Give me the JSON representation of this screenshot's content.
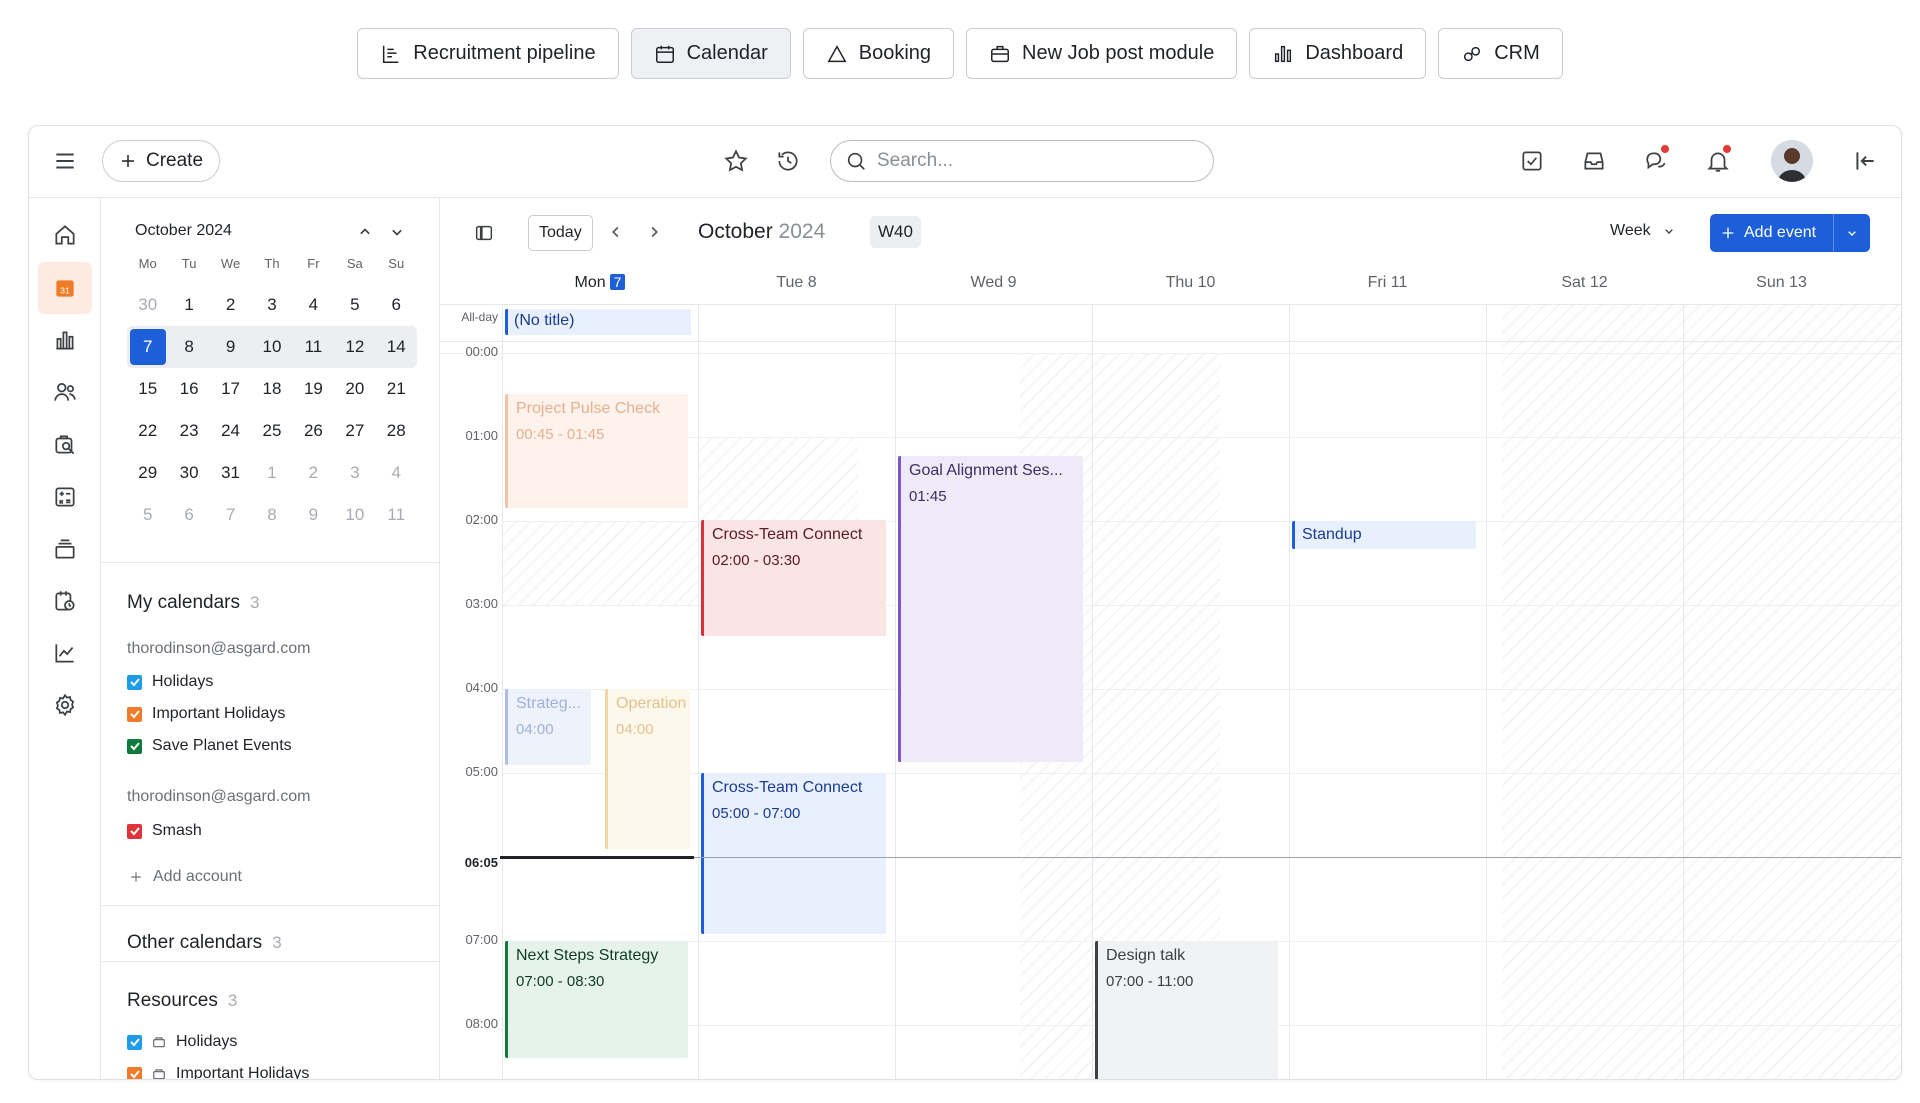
{
  "module_tabs": [
    {
      "label": "Recruitment pipeline",
      "icon": "pipeline-icon",
      "active": false
    },
    {
      "label": "Calendar",
      "icon": "calendar-icon",
      "active": true
    },
    {
      "label": "Booking",
      "icon": "triangle-icon",
      "active": false
    },
    {
      "label": "New Job post module",
      "icon": "briefcase-icon",
      "active": false
    },
    {
      "label": "Dashboard",
      "icon": "bar-chart-icon",
      "active": false
    },
    {
      "label": "CRM",
      "icon": "link-icon",
      "active": false
    }
  ],
  "topbar": {
    "create_label": "Create",
    "search_placeholder": "Search..."
  },
  "mini_calendar": {
    "title": "October 2024",
    "weekdays": [
      "Mo",
      "Tu",
      "We",
      "Th",
      "Fr",
      "Sa",
      "Su"
    ],
    "weeks": [
      [
        "30",
        "1",
        "2",
        "3",
        "4",
        "5",
        "6"
      ],
      [
        "7",
        "8",
        "9",
        "10",
        "11",
        "12",
        "14"
      ],
      [
        "15",
        "16",
        "17",
        "18",
        "19",
        "20",
        "21"
      ],
      [
        "22",
        "23",
        "24",
        "25",
        "26",
        "27",
        "28"
      ],
      [
        "29",
        "30",
        "31",
        "1",
        "2",
        "3",
        "4"
      ],
      [
        "5",
        "6",
        "7",
        "8",
        "9",
        "10",
        "11"
      ]
    ],
    "selected_day": "7"
  },
  "my_calendars": {
    "title": "My calendars",
    "count": "3",
    "accounts": [
      {
        "email": "thorodinson@asgard.com",
        "items": [
          {
            "label": "Holidays",
            "color": "#1e9be9"
          },
          {
            "label": "Important Holidays",
            "color": "#f07c2a"
          },
          {
            "label": "Save Planet Events",
            "color": "#0f7b3b"
          }
        ]
      },
      {
        "email": "thorodinson@asgard.com",
        "items": [
          {
            "label": "Smash",
            "color": "#e0333a"
          }
        ]
      }
    ],
    "add_account": "Add account"
  },
  "other_calendars": {
    "title": "Other calendars",
    "count": "3"
  },
  "resources": {
    "title": "Resources",
    "count": "3",
    "items": [
      {
        "label": "Holidays",
        "color": "#1e9be9"
      },
      {
        "label": "Important Holidays",
        "color": "#f07c2a"
      }
    ]
  },
  "toolbar": {
    "today": "Today",
    "month": "October",
    "year": "2024",
    "week": "W40",
    "view": "Week",
    "add_event": "Add event"
  },
  "days": [
    {
      "name": "Mon",
      "num": "7",
      "today": true
    },
    {
      "name": "Tue 8"
    },
    {
      "name": "Wed 9"
    },
    {
      "name": "Thu 10"
    },
    {
      "name": "Fri 11"
    },
    {
      "name": "Sat 12"
    },
    {
      "name": "Sun 13"
    }
  ],
  "allday_label": "All-day",
  "hours": [
    "00:00",
    "01:00",
    "02:00",
    "03:00",
    "04:00",
    "05:00",
    "06:05",
    "07:00",
    "08:00"
  ],
  "now_label": "06:05",
  "events": [
    {
      "title": "(No title)",
      "time": ""
    },
    {
      "title": "Project Pulse Check",
      "time": "00:45 - 01:45"
    },
    {
      "title": "Goal Alignment Ses...",
      "time": "01:45"
    },
    {
      "title": "Cross-Team Connect",
      "time": "02:00 - 03:30"
    },
    {
      "title": "Standup",
      "time": ""
    },
    {
      "title": "Strateg...",
      "time": "04:00"
    },
    {
      "title": "Operation",
      "time": "04:00"
    },
    {
      "title": "Cross-Team Connect",
      "time": "05:00 - 07:00"
    },
    {
      "title": "Next Steps Strategy",
      "time": "07:00 - 08:30"
    },
    {
      "title": "Design talk",
      "time": "07:00 - 11:00"
    }
  ]
}
